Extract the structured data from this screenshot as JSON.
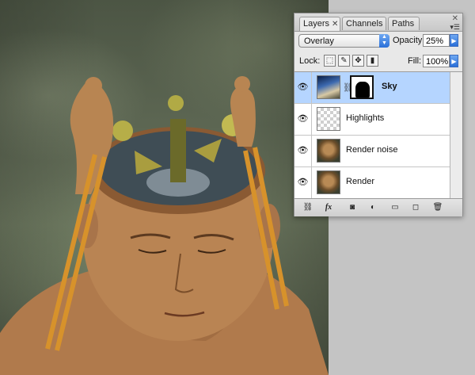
{
  "canvas": {
    "sky_color": "#5d6753",
    "workspace_color": "#c4c4c4"
  },
  "panel": {
    "tabs": [
      {
        "label": "Layers",
        "active": true
      },
      {
        "label": "Channels",
        "active": false
      },
      {
        "label": "Paths",
        "active": false
      }
    ],
    "tab_close": "✕",
    "blend_mode": "Overlay",
    "opacity_label": "Opacity:",
    "opacity_value": "25%",
    "lock_label": "Lock:",
    "fill_label": "Fill:",
    "fill_value": "100%",
    "layers": [
      {
        "name": "Sky",
        "selected": true,
        "thumb": "sky",
        "has_mask": true
      },
      {
        "name": "Highlights",
        "selected": false,
        "thumb": "transparent",
        "has_mask": false
      },
      {
        "name": "Render noise",
        "selected": false,
        "thumb": "render",
        "has_mask": false
      },
      {
        "name": "Render",
        "selected": false,
        "thumb": "render",
        "has_mask": false
      }
    ],
    "bottom_icons": [
      "link-icon",
      "fx-icon",
      "mask-icon",
      "adjustment-icon",
      "folder-icon",
      "new-layer-icon",
      "trash-icon"
    ],
    "fx_label": "fx"
  }
}
